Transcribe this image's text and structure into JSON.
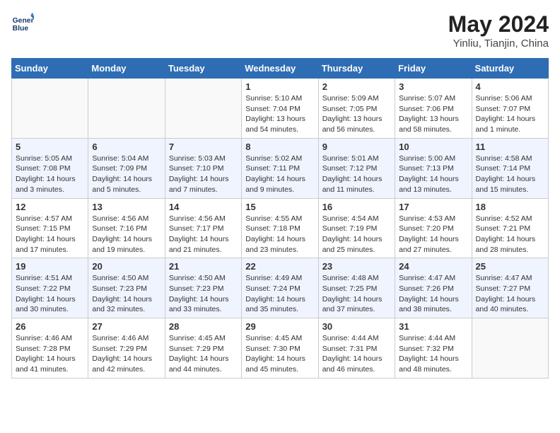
{
  "header": {
    "logo_line1": "General",
    "logo_line2": "Blue",
    "month_title": "May 2024",
    "location": "Yinliu, Tianjin, China"
  },
  "weekdays": [
    "Sunday",
    "Monday",
    "Tuesday",
    "Wednesday",
    "Thursday",
    "Friday",
    "Saturday"
  ],
  "weeks": [
    [
      {
        "day": "",
        "info": ""
      },
      {
        "day": "",
        "info": ""
      },
      {
        "day": "",
        "info": ""
      },
      {
        "day": "1",
        "info": "Sunrise: 5:10 AM\nSunset: 7:04 PM\nDaylight: 13 hours\nand 54 minutes."
      },
      {
        "day": "2",
        "info": "Sunrise: 5:09 AM\nSunset: 7:05 PM\nDaylight: 13 hours\nand 56 minutes."
      },
      {
        "day": "3",
        "info": "Sunrise: 5:07 AM\nSunset: 7:06 PM\nDaylight: 13 hours\nand 58 minutes."
      },
      {
        "day": "4",
        "info": "Sunrise: 5:06 AM\nSunset: 7:07 PM\nDaylight: 14 hours\nand 1 minute."
      }
    ],
    [
      {
        "day": "5",
        "info": "Sunrise: 5:05 AM\nSunset: 7:08 PM\nDaylight: 14 hours\nand 3 minutes."
      },
      {
        "day": "6",
        "info": "Sunrise: 5:04 AM\nSunset: 7:09 PM\nDaylight: 14 hours\nand 5 minutes."
      },
      {
        "day": "7",
        "info": "Sunrise: 5:03 AM\nSunset: 7:10 PM\nDaylight: 14 hours\nand 7 minutes."
      },
      {
        "day": "8",
        "info": "Sunrise: 5:02 AM\nSunset: 7:11 PM\nDaylight: 14 hours\nand 9 minutes."
      },
      {
        "day": "9",
        "info": "Sunrise: 5:01 AM\nSunset: 7:12 PM\nDaylight: 14 hours\nand 11 minutes."
      },
      {
        "day": "10",
        "info": "Sunrise: 5:00 AM\nSunset: 7:13 PM\nDaylight: 14 hours\nand 13 minutes."
      },
      {
        "day": "11",
        "info": "Sunrise: 4:58 AM\nSunset: 7:14 PM\nDaylight: 14 hours\nand 15 minutes."
      }
    ],
    [
      {
        "day": "12",
        "info": "Sunrise: 4:57 AM\nSunset: 7:15 PM\nDaylight: 14 hours\nand 17 minutes."
      },
      {
        "day": "13",
        "info": "Sunrise: 4:56 AM\nSunset: 7:16 PM\nDaylight: 14 hours\nand 19 minutes."
      },
      {
        "day": "14",
        "info": "Sunrise: 4:56 AM\nSunset: 7:17 PM\nDaylight: 14 hours\nand 21 minutes."
      },
      {
        "day": "15",
        "info": "Sunrise: 4:55 AM\nSunset: 7:18 PM\nDaylight: 14 hours\nand 23 minutes."
      },
      {
        "day": "16",
        "info": "Sunrise: 4:54 AM\nSunset: 7:19 PM\nDaylight: 14 hours\nand 25 minutes."
      },
      {
        "day": "17",
        "info": "Sunrise: 4:53 AM\nSunset: 7:20 PM\nDaylight: 14 hours\nand 27 minutes."
      },
      {
        "day": "18",
        "info": "Sunrise: 4:52 AM\nSunset: 7:21 PM\nDaylight: 14 hours\nand 28 minutes."
      }
    ],
    [
      {
        "day": "19",
        "info": "Sunrise: 4:51 AM\nSunset: 7:22 PM\nDaylight: 14 hours\nand 30 minutes."
      },
      {
        "day": "20",
        "info": "Sunrise: 4:50 AM\nSunset: 7:23 PM\nDaylight: 14 hours\nand 32 minutes."
      },
      {
        "day": "21",
        "info": "Sunrise: 4:50 AM\nSunset: 7:23 PM\nDaylight: 14 hours\nand 33 minutes."
      },
      {
        "day": "22",
        "info": "Sunrise: 4:49 AM\nSunset: 7:24 PM\nDaylight: 14 hours\nand 35 minutes."
      },
      {
        "day": "23",
        "info": "Sunrise: 4:48 AM\nSunset: 7:25 PM\nDaylight: 14 hours\nand 37 minutes."
      },
      {
        "day": "24",
        "info": "Sunrise: 4:47 AM\nSunset: 7:26 PM\nDaylight: 14 hours\nand 38 minutes."
      },
      {
        "day": "25",
        "info": "Sunrise: 4:47 AM\nSunset: 7:27 PM\nDaylight: 14 hours\nand 40 minutes."
      }
    ],
    [
      {
        "day": "26",
        "info": "Sunrise: 4:46 AM\nSunset: 7:28 PM\nDaylight: 14 hours\nand 41 minutes."
      },
      {
        "day": "27",
        "info": "Sunrise: 4:46 AM\nSunset: 7:29 PM\nDaylight: 14 hours\nand 42 minutes."
      },
      {
        "day": "28",
        "info": "Sunrise: 4:45 AM\nSunset: 7:29 PM\nDaylight: 14 hours\nand 44 minutes."
      },
      {
        "day": "29",
        "info": "Sunrise: 4:45 AM\nSunset: 7:30 PM\nDaylight: 14 hours\nand 45 minutes."
      },
      {
        "day": "30",
        "info": "Sunrise: 4:44 AM\nSunset: 7:31 PM\nDaylight: 14 hours\nand 46 minutes."
      },
      {
        "day": "31",
        "info": "Sunrise: 4:44 AM\nSunset: 7:32 PM\nDaylight: 14 hours\nand 48 minutes."
      },
      {
        "day": "",
        "info": ""
      }
    ]
  ]
}
